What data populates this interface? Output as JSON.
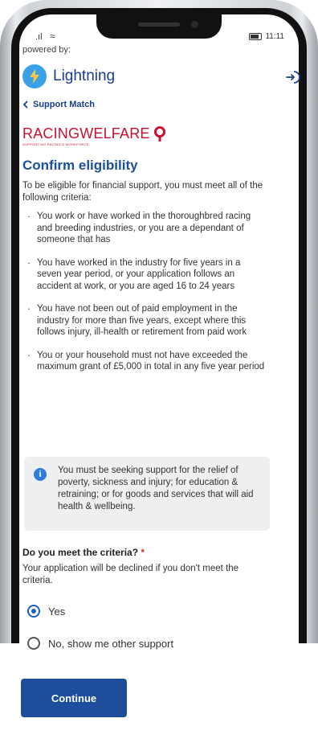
{
  "status_bar": {
    "time": "11:11",
    "signal": ".ıl",
    "wifi": "≈"
  },
  "header": {
    "powered_by": "powered by:",
    "brand_name": "Lightning",
    "back_label": "Support Match"
  },
  "partner": {
    "name": "RACINGWELFARE",
    "tagline": "SUPPORTING RACING'S WORKFORCE"
  },
  "page": {
    "title": "Confirm eligibility",
    "intro": "To be eligible for financial support, you must meet all of the following criteria:",
    "criteria": [
      "You work or have worked in the thoroughbred racing and breeding industries, or you are a dependant of someone that has",
      "You have worked in the industry for five years in a seven year period, or your application follows an accident at work, or you are aged 16 to 24 years",
      "You have not been out of paid employment in the industry for more than five years, except where this follows injury, ill-health or retirement from paid work",
      "You or your household must not have exceeded the maximum grant of £5,000 in total in any five year period"
    ],
    "info": "You must be seeking support for the relief of poverty, sickness and injury; for education & retraining; or for goods and services that will aid health & wellbeing."
  },
  "form": {
    "question": "Do you meet the criteria?",
    "required_mark": "*",
    "help": "Your application will be declined if you don't meet the criteria.",
    "options": [
      {
        "label": "Yes",
        "selected": true
      },
      {
        "label": "No, show me other support",
        "selected": false
      }
    ],
    "continue_label": "Continue"
  },
  "colors": {
    "brand_blue": "#1a3d8f",
    "title_blue": "#1a4f9c",
    "button_blue": "#1d4d9b",
    "racing_red": "#c8102e",
    "info_blue": "#2f7ddb"
  }
}
